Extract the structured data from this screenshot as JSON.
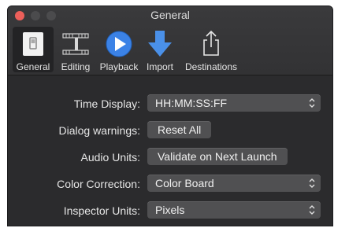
{
  "window": {
    "title": "General"
  },
  "tabs": [
    {
      "label": "General",
      "icon": "general-switch-icon"
    },
    {
      "label": "Editing",
      "icon": "film-strip-icon"
    },
    {
      "label": "Playback",
      "icon": "play-icon"
    },
    {
      "label": "Import",
      "icon": "down-arrow-icon"
    },
    {
      "label": "Destinations",
      "icon": "share-icon"
    }
  ],
  "settings": {
    "time_display": {
      "label": "Time Display:",
      "value": "HH:MM:SS:FF"
    },
    "dialog_warnings": {
      "label": "Dialog warnings:",
      "button": "Reset All"
    },
    "audio_units": {
      "label": "Audio Units:",
      "button": "Validate on Next Launch"
    },
    "color_correction": {
      "label": "Color Correction:",
      "value": "Color Board"
    },
    "inspector_units": {
      "label": "Inspector Units:",
      "value": "Pixels"
    }
  },
  "colors": {
    "accent_blue": "#3b82e6",
    "close_red": "#ec5f5a",
    "window_bg": "#2b2b2d"
  }
}
